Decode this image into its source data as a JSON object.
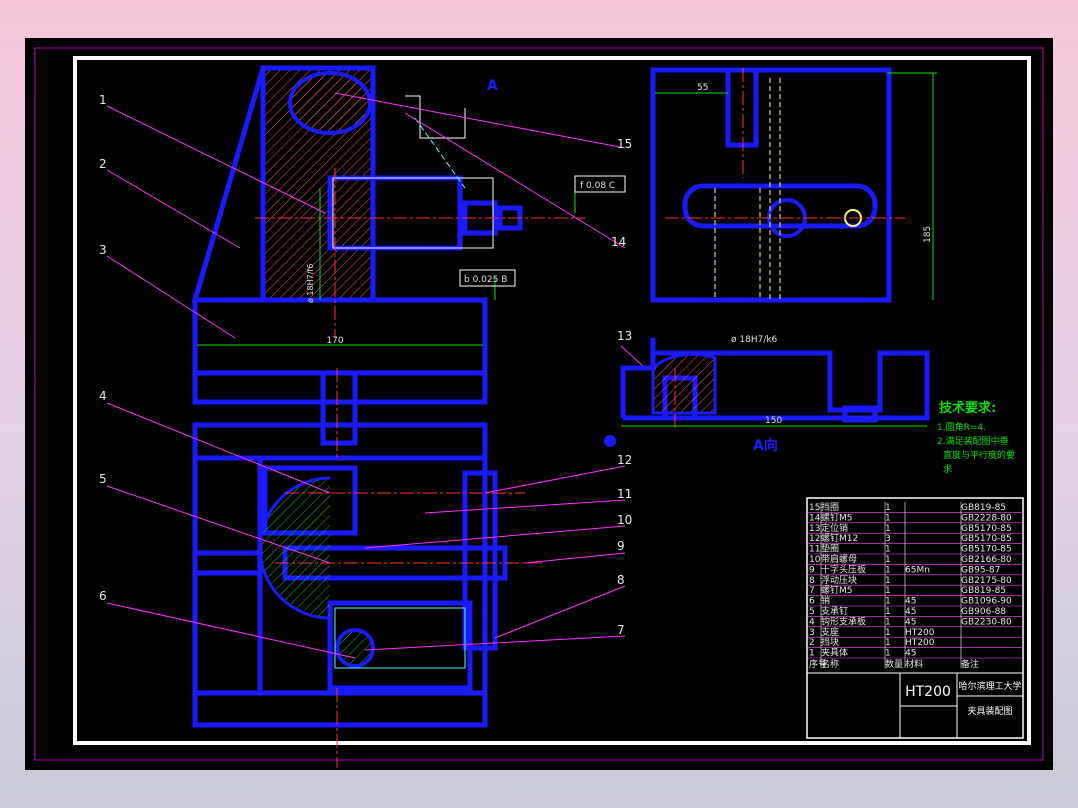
{
  "drawing": {
    "view_mark": "A",
    "view_mark_bottom": "A向",
    "part_numbers": [
      "1",
      "2",
      "3",
      "4",
      "5",
      "6",
      "7",
      "8",
      "9",
      "10",
      "11",
      "12",
      "13",
      "14",
      "15"
    ],
    "dimensions": {
      "base_width": "170",
      "tolerance_bore_left": "ø 18H7/f6",
      "flatness": "f 0.08 C",
      "parallelism": "b 0.025 B",
      "offset_top": "55",
      "height_right": "185",
      "fit_bore_right": "ø 18H7/k6",
      "base_length_right": "150"
    },
    "tech_requirements": {
      "title": "技术要求:",
      "items": [
        "1.圆角R=4.",
        "2.满足装配图中垂",
        "直度与平行度的要",
        "求"
      ]
    }
  },
  "title_block": {
    "material": "HT200",
    "school": "哈尔滨理工大学",
    "drawing_name": "夹具装配图",
    "header_labels": {
      "num": "序号",
      "name": "名称",
      "qty": "数量",
      "mat": "材料",
      "std": "备注"
    },
    "parts": [
      {
        "num": "15",
        "name": "挡圈",
        "qty": "1",
        "mat": "",
        "std": "GB819-85"
      },
      {
        "num": "14",
        "name": "螺钉M5",
        "qty": "1",
        "mat": "",
        "std": "GB2228-80"
      },
      {
        "num": "13",
        "name": "定位销",
        "qty": "1",
        "mat": "",
        "std": "GB5170-85"
      },
      {
        "num": "12",
        "name": "螺钉M12",
        "qty": "3",
        "mat": "",
        "std": "GB5170-85"
      },
      {
        "num": "11",
        "name": "垫圈",
        "qty": "1",
        "mat": "",
        "std": "GB5170-85"
      },
      {
        "num": "10",
        "name": "带肩螺母",
        "qty": "1",
        "mat": "",
        "std": "GB2166-80"
      },
      {
        "num": "9",
        "name": "十字头压板",
        "qty": "1",
        "mat": "65Mn",
        "std": "GB95-87"
      },
      {
        "num": "8",
        "name": "浮动压块",
        "qty": "1",
        "mat": "",
        "std": "GB2175-80"
      },
      {
        "num": "7",
        "name": "螺钉M5",
        "qty": "1",
        "mat": "",
        "std": "GB819-85"
      },
      {
        "num": "6",
        "name": "销",
        "qty": "1",
        "mat": "45",
        "std": "GB1096-90"
      },
      {
        "num": "5",
        "name": "支承钉",
        "qty": "1",
        "mat": "45",
        "std": "GB906-88"
      },
      {
        "num": "4",
        "name": "钩形支承板",
        "qty": "1",
        "mat": "45",
        "std": "GB2230-80"
      },
      {
        "num": "3",
        "name": "支座",
        "qty": "1",
        "mat": "HT200",
        "std": ""
      },
      {
        "num": "2",
        "name": "挡块",
        "qty": "1",
        "mat": "HT200",
        "std": ""
      },
      {
        "num": "1",
        "name": "夹具体",
        "qty": "1",
        "mat": "45",
        "std": ""
      }
    ]
  },
  "colors": {
    "outline": "#1a1aff",
    "hatch": "#ff5050",
    "dim": "#00e000",
    "leader": "#ff30ff",
    "center": "#ff3030",
    "hidden": "#ffff60",
    "cyan": "#40ffff"
  }
}
